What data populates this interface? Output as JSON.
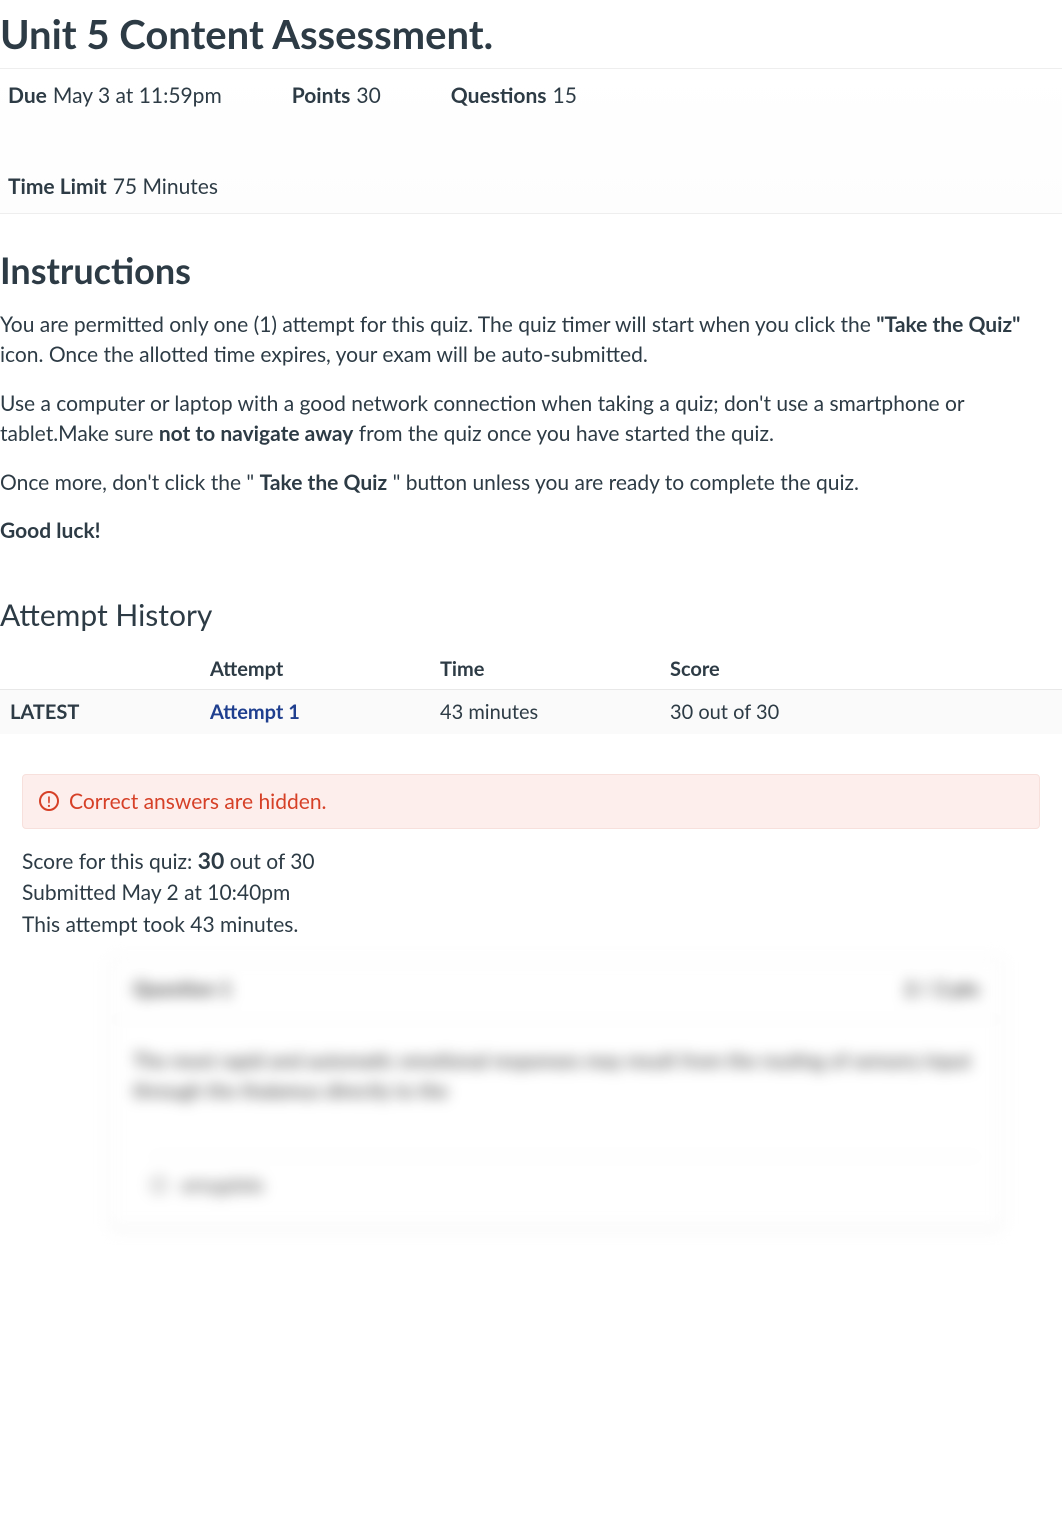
{
  "title": "Unit 5 Content Assessment.",
  "meta": {
    "due_label": "Due",
    "due_value": "May 3 at 11:59pm",
    "points_label": "Points",
    "points_value": "30",
    "questions_label": "Questions",
    "questions_value": "15",
    "time_limit_label": "Time Limit",
    "time_limit_value": "75 Minutes"
  },
  "instructions": {
    "heading": "Instructions",
    "p1_a": "You are permitted only one (1) attempt for this quiz. The quiz timer will start when you click the ",
    "p1_b": "\"Take the Quiz\"",
    "p1_c": " icon. Once the allotted time expires, your exam will be auto-submitted.",
    "p2_a": "Use a computer or laptop with a good network connection when taking a quiz; don't use a smartphone or tablet.Make sure ",
    "p2_b": "not to navigate away",
    "p2_c": " from the quiz once you have started the quiz.",
    "p3_a": "Once more, don't click the \"",
    "p3_b": "Take the Quiz",
    "p3_c": "\" button unless you are ready to complete the quiz.",
    "p4": "Good luck!"
  },
  "attempt_history": {
    "heading": "Attempt History",
    "columns": {
      "flag": "",
      "attempt": "Attempt",
      "time": "Time",
      "score": "Score"
    },
    "rows": [
      {
        "flag": "LATEST",
        "attempt": "Attempt 1",
        "time": "43 minutes",
        "score": "30 out of 30"
      }
    ]
  },
  "alert": {
    "icon_glyph": "!",
    "text": "Correct answers are hidden."
  },
  "summary": {
    "score_prefix": "Score for this quiz: ",
    "score_value": "30",
    "score_suffix": " out of 30",
    "submitted": "Submitted May 2 at 10:40pm",
    "duration": "This attempt took 43 minutes."
  },
  "question_preview": {
    "header_left": "Question 1",
    "header_right": "2 / 2 pts",
    "body": "The most rapid and automatic emotional responses may result from the routing of sensory input through the thalamus directly to the",
    "answer": "amygdala"
  }
}
